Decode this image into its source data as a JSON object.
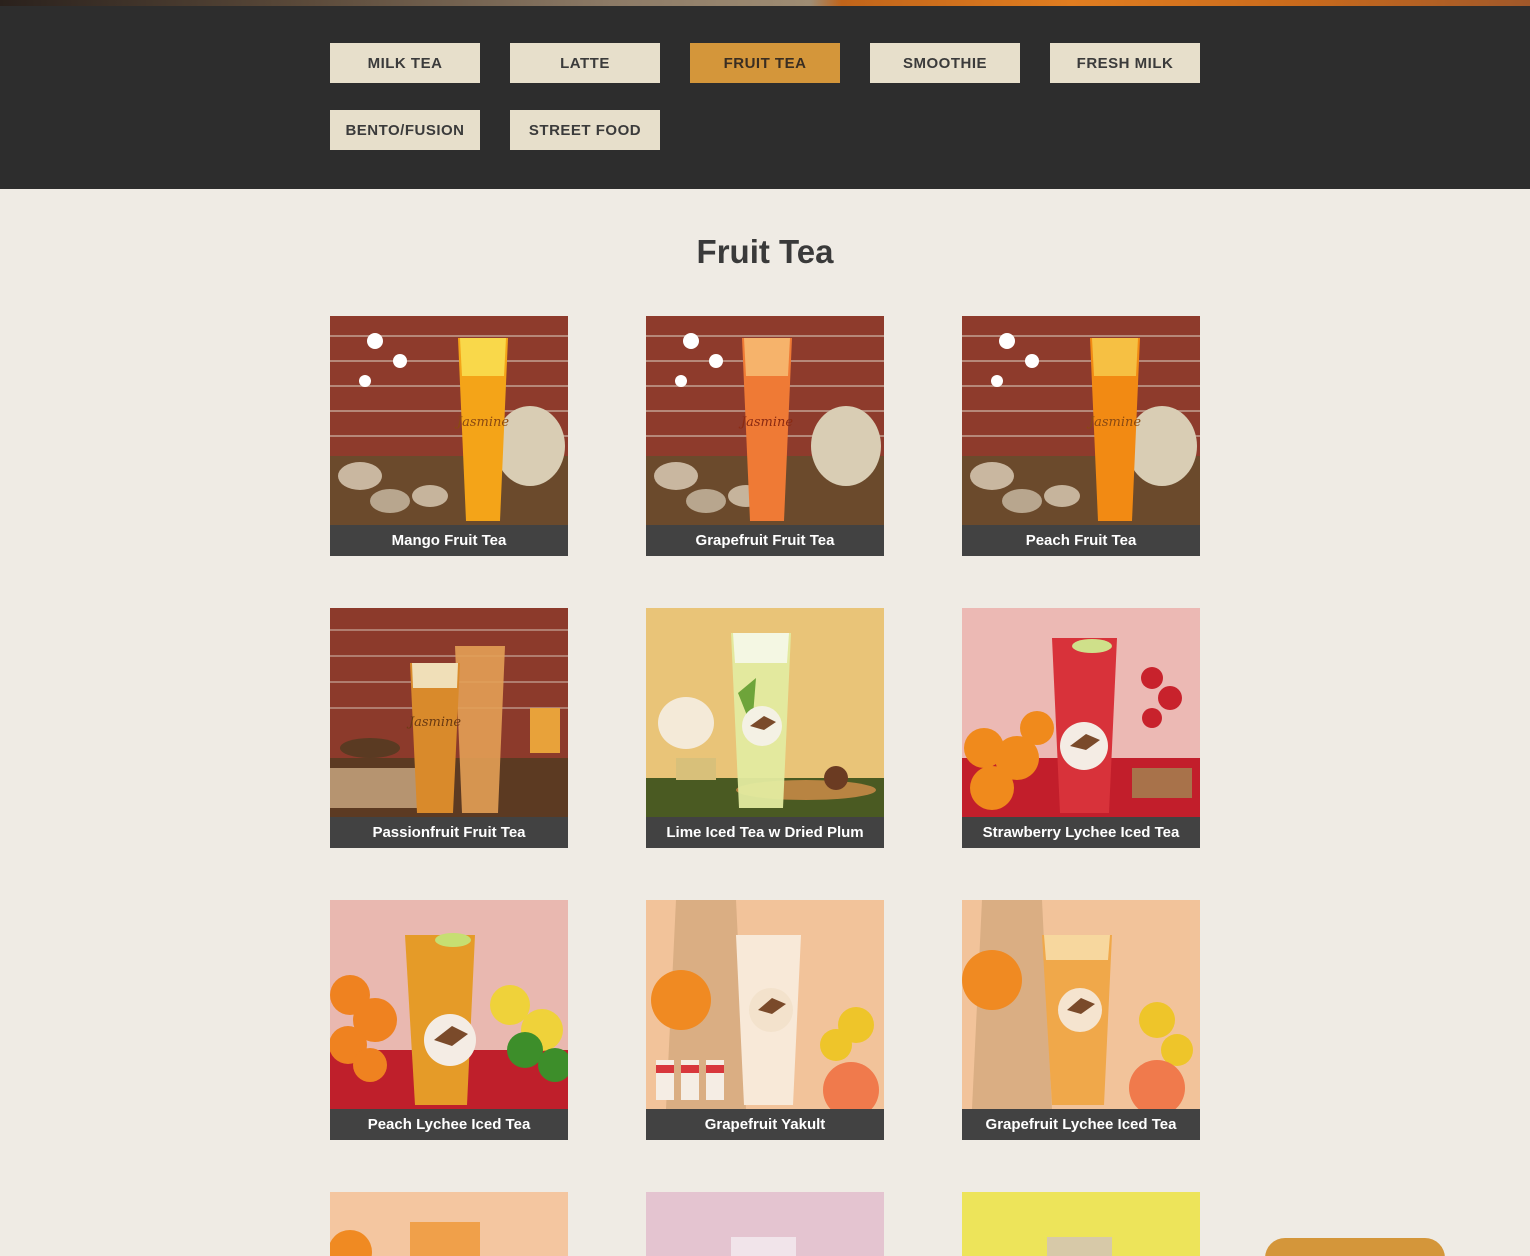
{
  "categories": [
    {
      "label": "MILK TEA",
      "active": false
    },
    {
      "label": "LATTE",
      "active": false
    },
    {
      "label": "FRUIT TEA",
      "active": true
    },
    {
      "label": "SMOOTHIE",
      "active": false
    },
    {
      "label": "FRESH MILK",
      "active": false
    },
    {
      "label": "BENTO/FUSION",
      "active": false
    },
    {
      "label": "STREET FOOD",
      "active": false
    }
  ],
  "section": {
    "title": "Fruit Tea"
  },
  "products": [
    {
      "name": "Mango Fruit Tea"
    },
    {
      "name": "Grapefruit Fruit Tea"
    },
    {
      "name": "Peach Fruit Tea"
    },
    {
      "name": "Passionfruit Fruit Tea"
    },
    {
      "name": "Lime Iced Tea w Dried Plum"
    },
    {
      "name": "Strawberry Lychee Iced Tea"
    },
    {
      "name": "Peach Lychee Iced Tea"
    },
    {
      "name": "Grapefruit Yakult"
    },
    {
      "name": "Grapefruit Lychee Iced Tea"
    }
  ],
  "colors": {
    "topbar": "#2d2d2d",
    "button_bg": "#e7dfcb",
    "button_active": "#d4963a",
    "caption_bg": "#424242",
    "page_bg": "#efebe4"
  }
}
